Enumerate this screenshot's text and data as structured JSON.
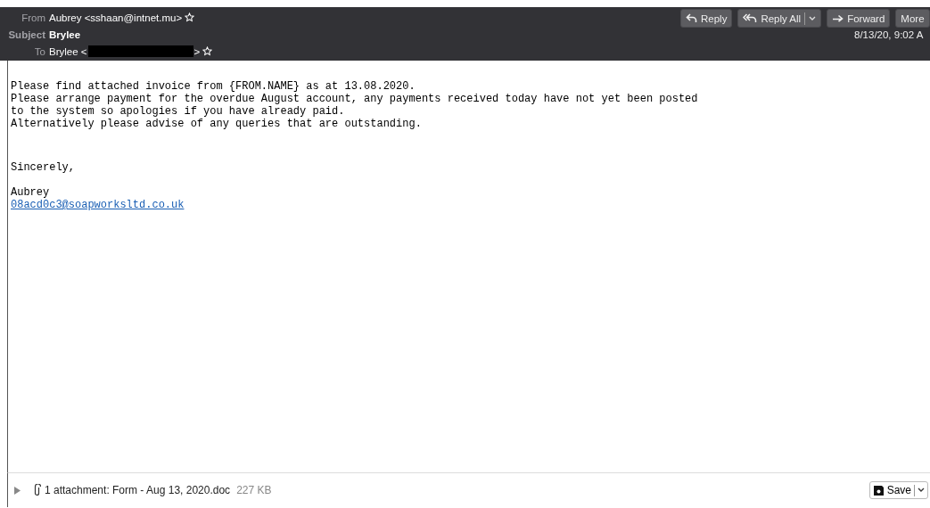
{
  "header": {
    "fields": [
      {
        "label": "From",
        "value": "Aubrey <sshaan@intnet.mu>",
        "kind": "address"
      },
      {
        "label": "Subject",
        "value": "Brylee",
        "kind": "subject"
      },
      {
        "label": "To",
        "value": "Brylee <",
        "after": ">",
        "kind": "redacted"
      }
    ],
    "actions": [
      {
        "label": "Reply",
        "split": false
      },
      {
        "label": "Reply All",
        "split": true
      },
      {
        "label": "Forward",
        "split": false
      },
      {
        "label": "More",
        "split": false
      }
    ],
    "date": "8/13/20, 9:02 A"
  },
  "body": {
    "paragraphs": [
      [
        "Please find attached invoice from {FROM.NAME} as at 13.08.2020.",
        "Please arrange payment for the overdue August account, any payments received today have not yet been posted",
        "to the system so apologies if you have already paid.",
        "Alternatively please advise of any queries that are outstanding."
      ],
      [
        "Sincerely,"
      ],
      [
        "Aubrey"
      ]
    ],
    "link": "08acd0c3@soapworksltd.co.uk"
  },
  "attachments": {
    "expanded": false,
    "summary": "1 attachment: Form - Aug 13, 2020.doc",
    "size": "227 KB",
    "save": "Save"
  }
}
